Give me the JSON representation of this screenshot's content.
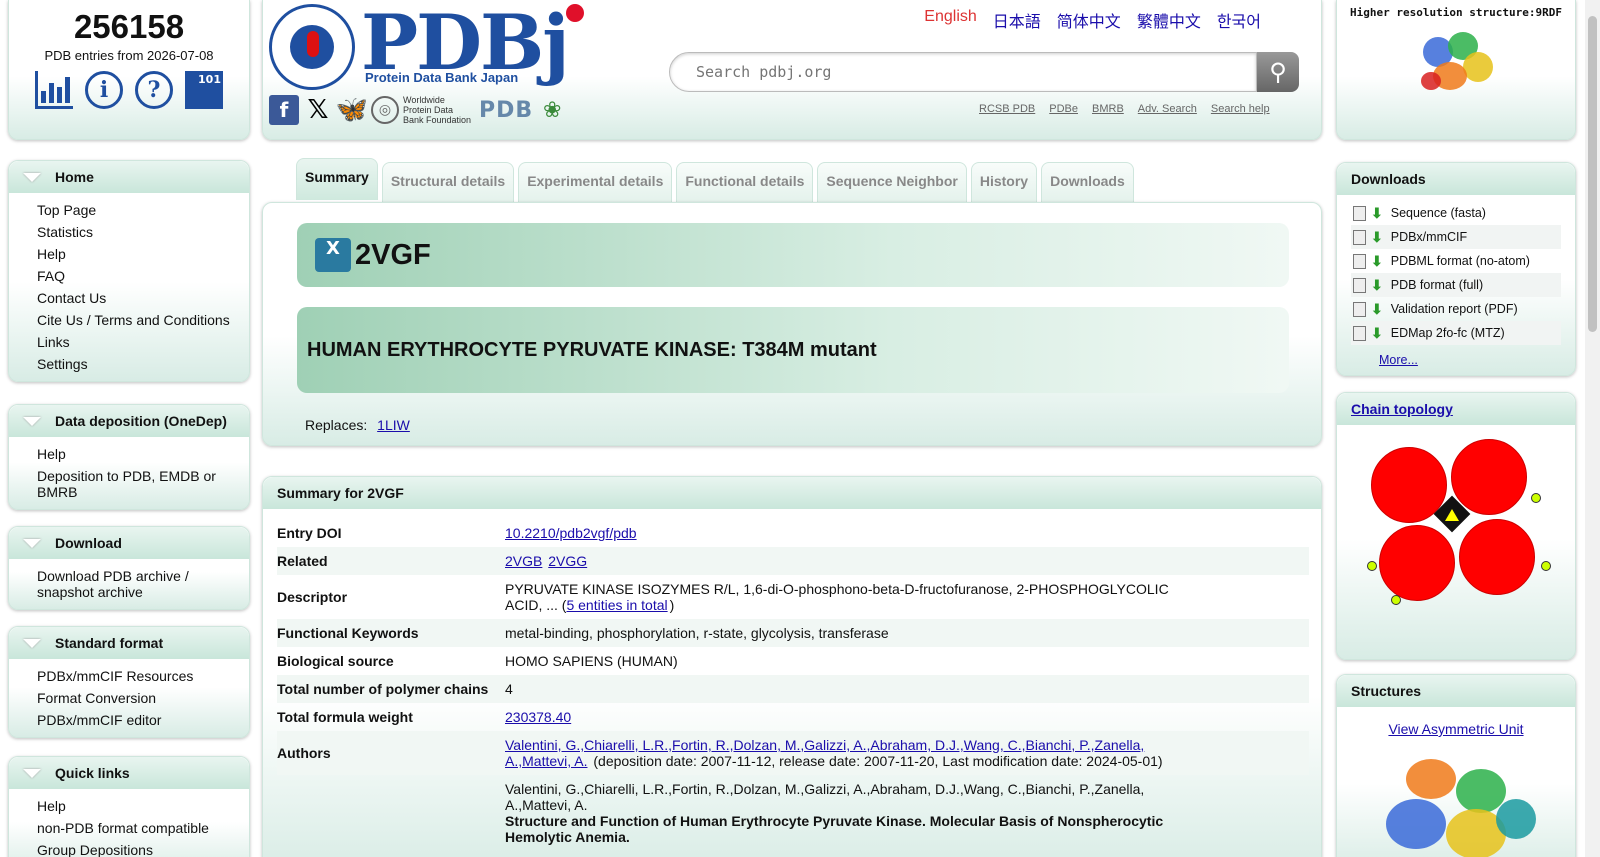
{
  "counter": {
    "count": "256158",
    "subtitle": "PDB entries from 2026-07-08"
  },
  "header": {
    "languages": [
      "English",
      "日本語",
      "简体中文",
      "繁體中文",
      "한국어"
    ],
    "active_language": "English",
    "logo_text": "PDBj",
    "logo_tagline": "Protein Data Bank Japan",
    "wwpdb_foundation": "Worldwide Protein Data Bank Foundation",
    "wwpdb_logo": "PDB",
    "search_placeholder": "Search pdbj.org",
    "top_links": [
      "RCSB PDB",
      "PDBe",
      "BMRB",
      "Adv. Search",
      "Search help"
    ]
  },
  "hires": {
    "label": "Higher resolution structure:9RDF"
  },
  "nav": {
    "home": {
      "title": "Home",
      "items": [
        "Top Page",
        "Statistics",
        "Help",
        "FAQ",
        "Contact Us",
        "Cite Us / Terms and Conditions",
        "Links",
        "Settings"
      ]
    },
    "deposition": {
      "title": "Data deposition (OneDep)",
      "items": [
        "Help",
        "Deposition to PDB, EMDB or BMRB"
      ]
    },
    "download": {
      "title": "Download",
      "items": [
        "Download PDB archive / snapshot archive"
      ]
    },
    "standard": {
      "title": "Standard format",
      "items": [
        "PDBx/mmCIF Resources",
        "Format Conversion",
        "PDBx/mmCIF editor"
      ]
    },
    "quick": {
      "title": "Quick links",
      "items": [
        "Help",
        "non-PDB format compatible",
        "Group Depositions"
      ]
    }
  },
  "tabs": [
    "Summary",
    "Structural details",
    "Experimental details",
    "Functional details",
    "Sequence Neighbor",
    "History",
    "Downloads"
  ],
  "entry": {
    "id": "2VGF",
    "title": "HUMAN ERYTHROCYTE PYRUVATE KINASE: T384M mutant",
    "replaces_label": "Replaces:",
    "replaces_id": "1LIW"
  },
  "summary": {
    "heading": "Summary for 2VGF",
    "rows": {
      "doi_label": "Entry DOI",
      "doi": "10.2210/pdb2vgf/pdb",
      "related_label": "Related",
      "related1": "2VGB",
      "related2": "2VGG",
      "descriptor_label": "Descriptor",
      "descriptor": "PYRUVATE KINASE ISOZYMES R/L, 1,6-di-O-phosphono-beta-D-fructofuranose, 2-PHOSPHOGLYCOLIC ACID, ... (",
      "descriptor_link": "5 entities in total",
      "descriptor_end": ")",
      "keywords_label": "Functional Keywords",
      "keywords": "metal-binding, phosphorylation, r-state, glycolysis, transferase",
      "source_label": "Biological source",
      "source": "HOMO SAPIENS (HUMAN)",
      "chains_label": "Total number of polymer chains",
      "chains": "4",
      "weight_label": "Total formula weight",
      "weight": "230378.40",
      "authors_label": "Authors",
      "authors_links": "Valentini, G.,Chiarelli, L.R.,Fortin, R.,Dolzan, M.,Galizzi, A.,Abraham, D.J.,Wang, C.,Bianchi, P.,Zanella, A.,Mattevi, A.",
      "authors_dates": " (deposition date: 2007-11-12, release date: 2007-11-20, Last modification date: 2024-05-01)",
      "citation_authors": "Valentini, G.,Chiarelli, L.R.,Fortin, R.,Dolzan, M.,Galizzi, A.,Abraham, D.J.,Wang, C.,Bianchi, P.,Zanella, A.,Mattevi, A.",
      "citation_title": "Structure and Function of Human Erythrocyte Pyruvate Kinase. Molecular Basis of Nonspherocytic Hemolytic Anemia."
    }
  },
  "downloads": {
    "title": "Downloads",
    "items": [
      "Sequence (fasta)",
      "PDBx/mmCIF",
      "PDBML format (no-atom)",
      "PDB format (full)",
      "Validation report (PDF)",
      "EDMap 2fo-fc (MTZ)"
    ],
    "more": "More..."
  },
  "topology": {
    "title": "Chain topology",
    "chain_color": "#ff0000"
  },
  "structures": {
    "title": "Structures",
    "view": "View Asymmetric Unit"
  }
}
